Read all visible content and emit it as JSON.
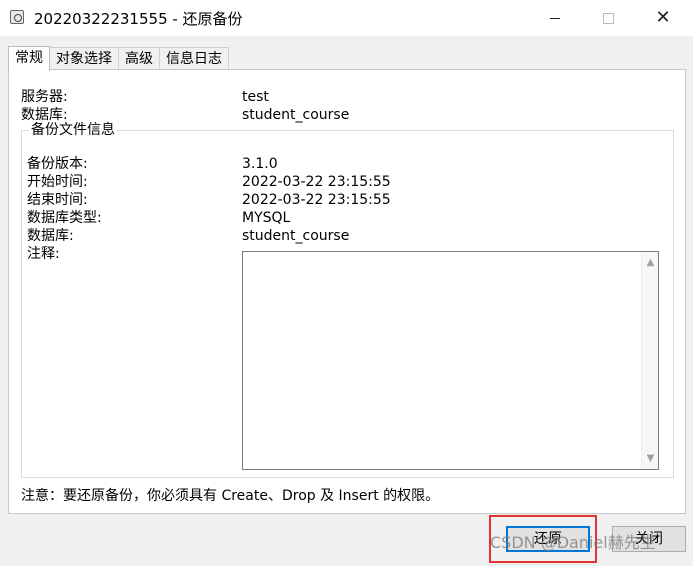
{
  "window": {
    "title": "20220322231555 - 还原备份",
    "close_glyph": "✕"
  },
  "tabs": [
    {
      "label": "常规",
      "active": true
    },
    {
      "label": "对象选择",
      "active": false
    },
    {
      "label": "高级",
      "active": false
    },
    {
      "label": "信息日志",
      "active": false
    }
  ],
  "general": {
    "server_label": "服务器:",
    "server_value": "test",
    "database_label": "数据库:",
    "database_value": "student_course"
  },
  "backup_info": {
    "group_title": "备份文件信息",
    "version_label": "备份版本:",
    "version_value": "3.1.0",
    "start_label": "开始时间:",
    "start_value": "2022-03-22 23:15:55",
    "end_label": "结束时间:",
    "end_value": "2022-03-22 23:15:55",
    "db_type_label": "数据库类型:",
    "db_type_value": "MYSQL",
    "db_label": "数据库:",
    "db_value": "student_course",
    "comment_label": "注释:",
    "comment_value": ""
  },
  "note": "注意：要还原备份，你必须具有 Create、Drop 及 Insert 的权限。",
  "buttons": {
    "restore": "还原",
    "close": "关闭"
  },
  "watermark": "CSDN @Daniel赫先生",
  "colors": {
    "highlight": "#e53333",
    "focus": "#0078d7"
  }
}
